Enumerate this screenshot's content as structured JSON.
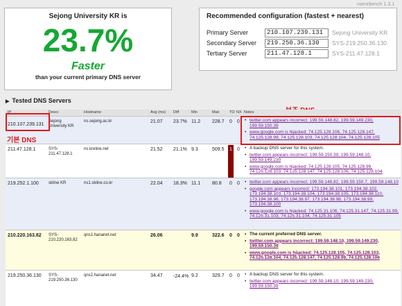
{
  "brand": "namebench 1.3.1",
  "summary": {
    "title": "Sejong University KR is",
    "percent": "23.7%",
    "faster": "Faster",
    "subtitle": "than your current primary DNS server"
  },
  "recommended": {
    "title": "Recommended configuration (fastest + nearest)",
    "servers": [
      {
        "label": "Primary Server",
        "ip": "210.107.239.131",
        "name": "Sejong University KR"
      },
      {
        "label": "Secondary Server",
        "ip": "219.250.36.130",
        "name": "SYS-219.250.36.130"
      },
      {
        "label": "Tertiary Server",
        "ip": "211.47.128.1",
        "name": "SYS-211.47.128.1"
      }
    ]
  },
  "tested_section": "Tested DNS Servers",
  "annotations": {
    "secondary": "보조 DNS",
    "primary": "기본 DNS"
  },
  "table": {
    "headers": [
      "IP",
      "Descr.",
      "Hostname",
      "Avg (ms)",
      "Diff",
      "Min",
      "Max",
      "TO",
      "NX",
      "Notes"
    ],
    "rows": [
      {
        "ip": "210.107.239.131",
        "descr": "Sejong University KR",
        "host": "ns.sejong.ac.kr",
        "avg": "21.07",
        "diff": "23.7%",
        "min": "11.2",
        "max": "228.7",
        "to": "0",
        "nx": "0",
        "notes": [
          {
            "text": "twitter.com appears incorrect: 199.59.148.82, 199.59.149.230, 199.59.150.39",
            "link": true
          },
          {
            "text": "www.google.com is hijacked: 74.125.128.106, 74.125.128.147, 74.125.128.99, 74.125.128.103, 74.125.128.104, 74.125.128.105",
            "link": true
          }
        ]
      },
      {
        "ip": "211.47.128.1",
        "descr": "SYS-211.47.128.1",
        "host": "ns.kreline.net",
        "avg": "21.52",
        "diff": "21.1%",
        "min": "9.3",
        "max": "509.5",
        "to": "1",
        "nx": "0",
        "notes": [
          {
            "text": "A backup DNS server for this system.",
            "link": false
          },
          {
            "text": "twitter.com appears incorrect: 199.59.150.39, 199.59.148.10, 199.59.149.230",
            "link": true
          },
          {
            "text": "www.google.com is hijacked: 74.125.128.105, 74.125.128.99, 74.125.128.103, 74.125.128.147, 74.125.128.106, 74.125.128.104",
            "link": true
          }
        ]
      },
      {
        "ip": "219.252.1.100",
        "descr": "skline KR",
        "host": "ns1.skline.co.kr",
        "avg": "22.04",
        "diff": "18.3%",
        "min": "11.1",
        "max": "80.8",
        "to": "0",
        "nx": "0",
        "notes": [
          {
            "text": "twitter.com appears incorrect: 199.59.148.82, 199.59.150.7, 199.59.148.10",
            "link": true
          },
          {
            "text": "google.com appears incorrect: 173.194.38.101, 173.194.38.102, 173.194.38.103, 173.194.38.104, 173.194.38.105, 173.194.38.110, 173.194.38.96, 173.194.38.97, 173.194.38.98, 173.194.38.99, 173.194.38.100",
            "link": true
          },
          {
            "text": "www.google.com is hijacked: 74.125.31.106, 74.125.31.147, 74.125.31.99, 74.125.31.103, 74.125.31.104, 74.125.31.105",
            "link": true
          }
        ]
      },
      {
        "ip": "210.220.163.82",
        "descr": "SYS-210.220.163.82",
        "host": "qns1.hananet.net",
        "avg": "26.06",
        "diff": "",
        "min": "9.9",
        "max": "322.6",
        "to": "0",
        "nx": "0",
        "notes": [
          {
            "text": "The current preferred DNS server.",
            "link": false
          },
          {
            "text": "twitter.com appears incorrect: 199.59.148.10, 199.59.149.230, 199.59.150.39",
            "link": true
          },
          {
            "text": "www.google.com is hijacked: 74.125.128.105, 74.125.128.103, 74.125.128.104, 74.125.128.147, 74.125.128.99, 74.125.128.106",
            "link": true
          }
        ]
      },
      {
        "ip": "219.250.36.130",
        "descr": "SYS-219.250.36.130",
        "host": "qns2.hananet.net",
        "avg": "34.47",
        "diff": "-24.4%",
        "min": "9.2",
        "max": "329.7",
        "to": "0",
        "nx": "0",
        "notes": [
          {
            "text": "A backup DNS server for this system.",
            "link": false
          },
          {
            "text": "twitter.com appears incorrect: 199.59.148.10, 199.59.149.230, 199.59.150.39",
            "link": true
          }
        ]
      }
    ]
  }
}
